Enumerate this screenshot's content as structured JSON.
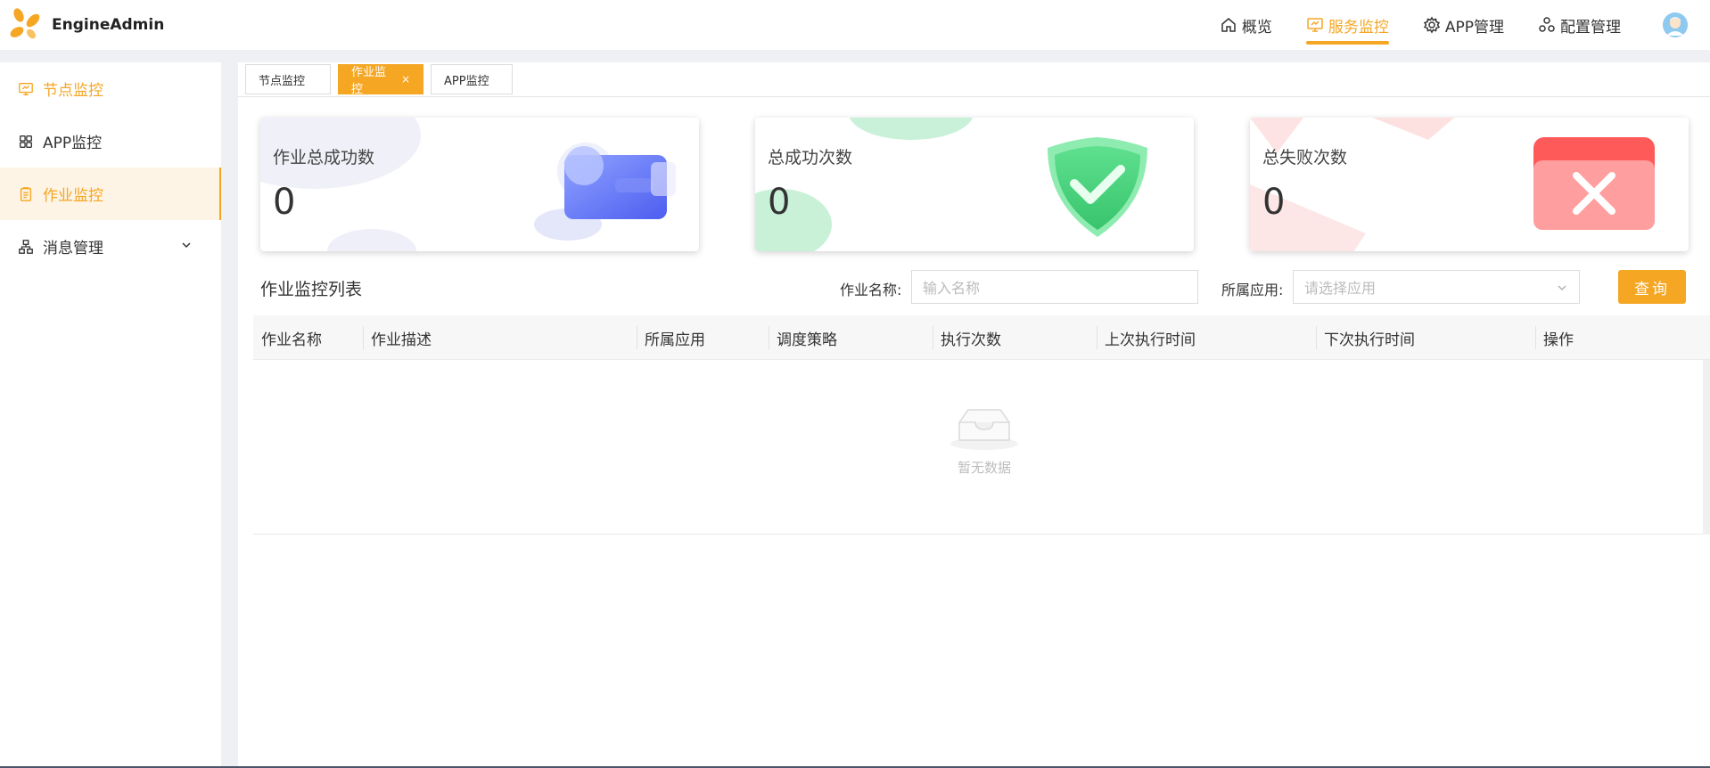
{
  "app": {
    "name": "EngineAdmin",
    "brand_color": "#f5a623"
  },
  "topnav": {
    "items": [
      {
        "label": "概览",
        "icon": "home-icon"
      },
      {
        "label": "服务监控",
        "icon": "monitor-icon",
        "active": true
      },
      {
        "label": "APP管理",
        "icon": "gear-icon"
      },
      {
        "label": "配置管理",
        "icon": "cluster-icon"
      }
    ]
  },
  "sidebar": {
    "items": [
      {
        "label": "节点监控",
        "icon": "monitor-icon"
      },
      {
        "label": "APP监控",
        "icon": "grid-icon"
      },
      {
        "label": "作业监控",
        "icon": "clipboard-icon",
        "active": true
      },
      {
        "label": "消息管理",
        "icon": "sitemap-icon",
        "expandable": true
      }
    ]
  },
  "tabs": [
    {
      "label": "节点监控"
    },
    {
      "label": "作业监控",
      "active": true,
      "close": "×"
    },
    {
      "label": "APP监控"
    }
  ],
  "stats": [
    {
      "title": "作业总成功数",
      "value": "0",
      "icon": "card-icon"
    },
    {
      "title": "总成功次数",
      "value": "0",
      "icon": "shield-check-icon"
    },
    {
      "title": "总失败次数",
      "value": "0",
      "icon": "error-x-icon"
    }
  ],
  "filter": {
    "section_title": "作业监控列表",
    "name_label": "作业名称:",
    "name_placeholder": "输入名称",
    "app_label": "所属应用:",
    "app_placeholder": "请选择应用",
    "query_button": "查询"
  },
  "table": {
    "columns": [
      "作业名称",
      "作业描述",
      "所属应用",
      "调度策略",
      "执行次数",
      "上次执行时间",
      "下次执行时间",
      "操作"
    ],
    "rows": [],
    "empty_text": "暂无数据"
  }
}
